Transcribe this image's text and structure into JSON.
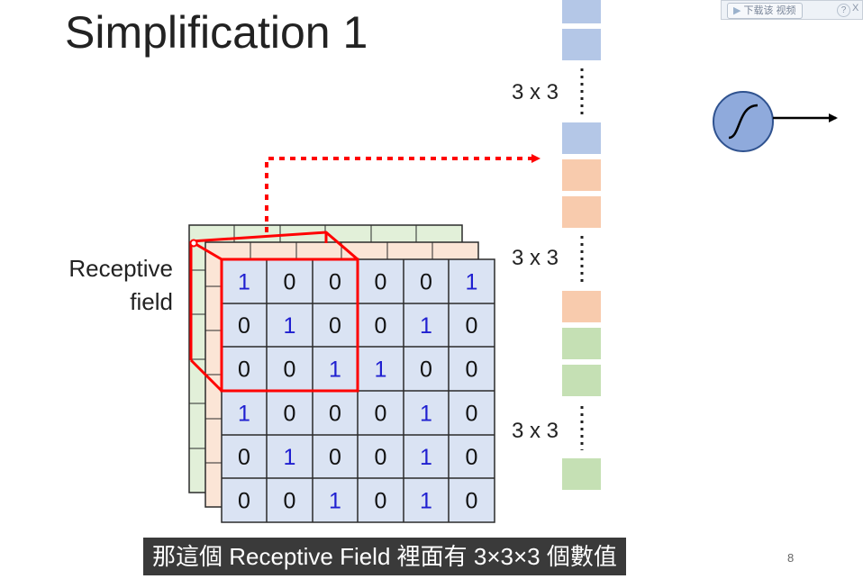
{
  "slide": {
    "title": "Simplification 1",
    "receptive_field_label_line1": "Receptive",
    "receptive_field_label_line2": "field",
    "page_number": "8"
  },
  "download_widget": {
    "button_label": "下载该 视频",
    "help_glyph": "?",
    "close_glyph": "X"
  },
  "subtitle": "那這個 Receptive Field 裡面有 3×3×3 個數值",
  "dimension_labels": [
    "3 x 3",
    "3 x 3",
    "3 x 3"
  ],
  "matrix_front": [
    [
      "1",
      "0",
      "0",
      "0",
      "0",
      "1"
    ],
    [
      "0",
      "1",
      "0",
      "0",
      "1",
      "0"
    ],
    [
      "0",
      "0",
      "1",
      "1",
      "0",
      "0"
    ],
    [
      "1",
      "0",
      "0",
      "0",
      "1",
      "0"
    ],
    [
      "0",
      "1",
      "0",
      "0",
      "1",
      "0"
    ],
    [
      "0",
      "0",
      "1",
      "0",
      "1",
      "0"
    ]
  ],
  "colors": {
    "blue_channel": "#dae3f3",
    "orange_channel": "#fbe5d6",
    "green_channel": "#e2f0d9",
    "blue_bar": "#b4c7e7",
    "orange_bar": "#f8cbad",
    "green_bar": "#c5e0b4",
    "highlight_red": "#ff0000",
    "one_digit": "#1f1fd0",
    "neuron_fill": "#8faadc"
  },
  "icons": [
    "sigmoid-icon",
    "arrow-right-icon",
    "play-icon"
  ]
}
